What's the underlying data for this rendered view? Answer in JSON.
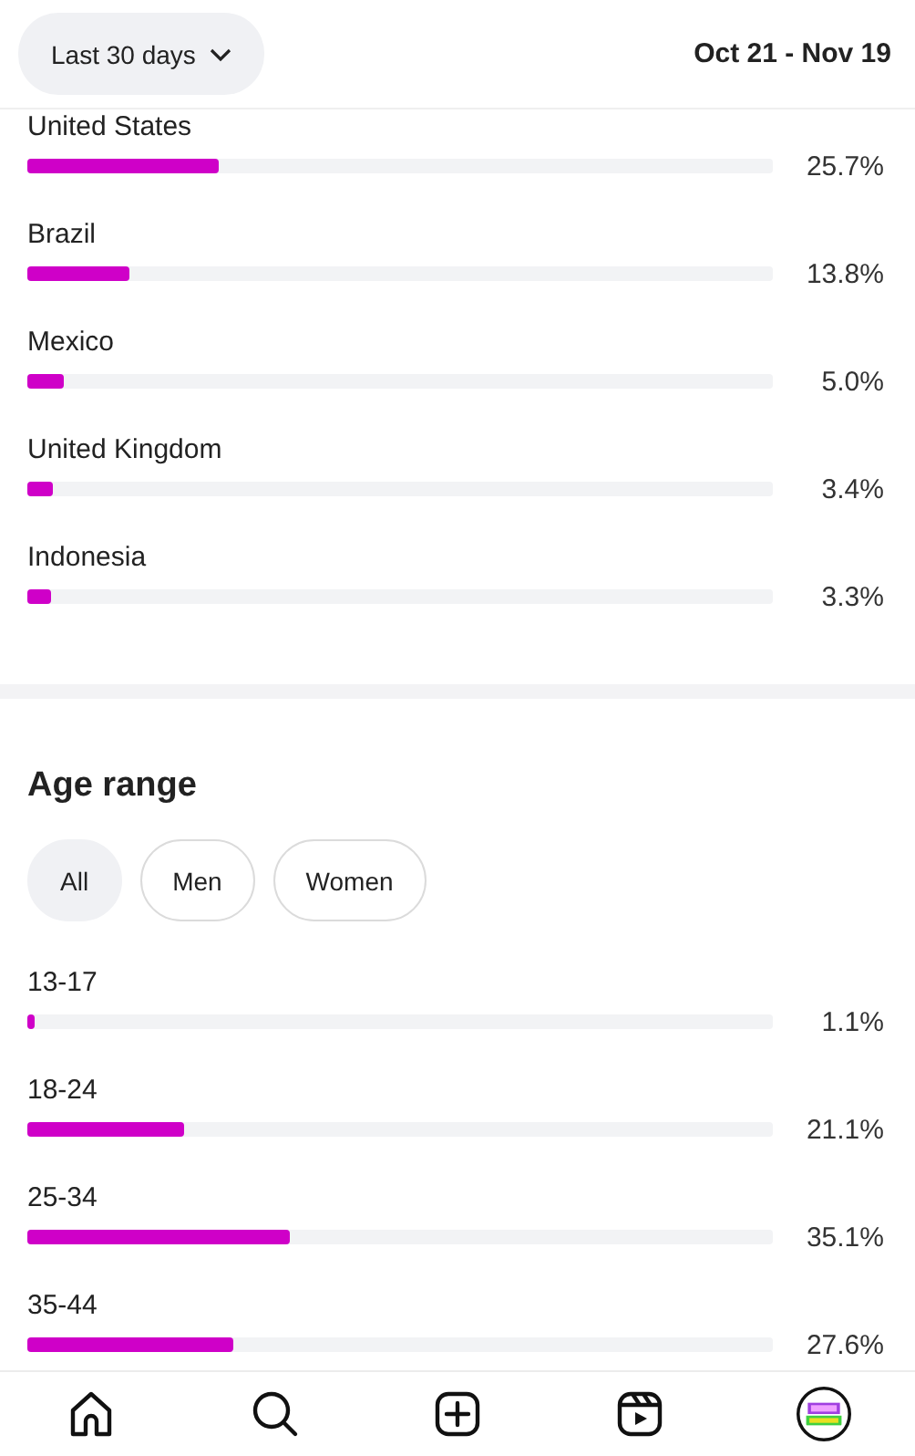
{
  "header": {
    "range_button": "Last 30 days",
    "date_range": "Oct 21 - Nov 19"
  },
  "countries": [
    {
      "name": "United States",
      "level": 0.257,
      "percent": "25.7%"
    },
    {
      "name": "Brazil",
      "level": 0.138,
      "percent": "13.8%"
    },
    {
      "name": "Mexico",
      "level": 0.05,
      "percent": "5.0%"
    },
    {
      "name": "United Kingdom",
      "level": 0.034,
      "percent": "3.4%"
    },
    {
      "name": "Indonesia",
      "level": 0.033,
      "percent": "3.3%"
    }
  ],
  "age_range": {
    "title": "Age range",
    "filters": [
      {
        "label": "All",
        "selected": true
      },
      {
        "label": "Men",
        "selected": false
      },
      {
        "label": "Women",
        "selected": false
      }
    ],
    "rows": [
      {
        "name": "13-17",
        "level": 0.011,
        "percent": "1.1%"
      },
      {
        "name": "18-24",
        "level": 0.211,
        "percent": "21.1%"
      },
      {
        "name": "25-34",
        "level": 0.351,
        "percent": "35.1%"
      },
      {
        "name": "35-44",
        "level": 0.276,
        "percent": "27.6%"
      }
    ]
  },
  "bottom_nav": [
    {
      "kind": "home"
    },
    {
      "kind": "search"
    },
    {
      "kind": "create"
    },
    {
      "kind": "reels"
    },
    {
      "kind": "profile"
    }
  ]
}
